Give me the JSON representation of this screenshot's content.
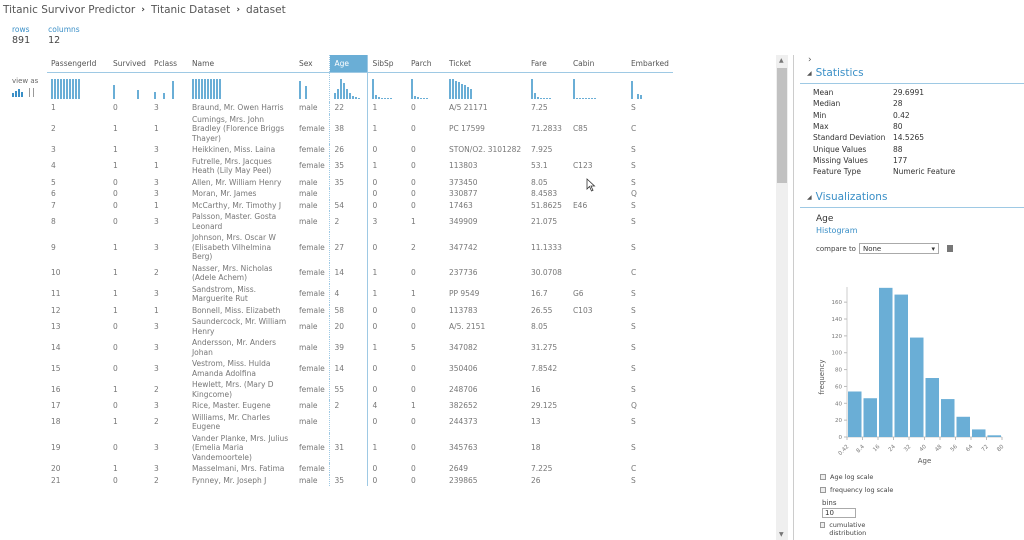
{
  "breadcrumb": [
    "Titanic Survivor Predictor",
    "Titanic Dataset",
    "dataset"
  ],
  "summary": {
    "rows_label": "rows",
    "rows": "891",
    "columns_label": "columns",
    "columns": "12"
  },
  "view_as_label": "view as",
  "columns": [
    "PassengerId",
    "Survived",
    "Pclass",
    "Name",
    "Sex",
    "Age",
    "SibSp",
    "Parch",
    "Ticket",
    "Fare",
    "Cabin",
    "Embarked"
  ],
  "selected_column": "Age",
  "rows": [
    [
      "1",
      "0",
      "3",
      "Braund, Mr. Owen Harris",
      "male",
      "22",
      "1",
      "0",
      "A/5 21171",
      "7.25",
      "",
      "S"
    ],
    [
      "2",
      "1",
      "1",
      "Cumings, Mrs. John Bradley (Florence Briggs Thayer)",
      "female",
      "38",
      "1",
      "0",
      "PC 17599",
      "71.2833",
      "C85",
      "C"
    ],
    [
      "3",
      "1",
      "3",
      "Heikkinen, Miss. Laina",
      "female",
      "26",
      "0",
      "0",
      "STON/O2. 3101282",
      "7.925",
      "",
      "S"
    ],
    [
      "4",
      "1",
      "1",
      "Futrelle, Mrs. Jacques Heath (Lily May Peel)",
      "female",
      "35",
      "1",
      "0",
      "113803",
      "53.1",
      "C123",
      "S"
    ],
    [
      "5",
      "0",
      "3",
      "Allen, Mr. William Henry",
      "male",
      "35",
      "0",
      "0",
      "373450",
      "8.05",
      "",
      "S"
    ],
    [
      "6",
      "0",
      "3",
      "Moran, Mr. James",
      "male",
      "",
      "0",
      "0",
      "330877",
      "8.4583",
      "",
      "Q"
    ],
    [
      "7",
      "0",
      "1",
      "McCarthy, Mr. Timothy J",
      "male",
      "54",
      "0",
      "0",
      "17463",
      "51.8625",
      "E46",
      "S"
    ],
    [
      "8",
      "0",
      "3",
      "Palsson, Master. Gosta Leonard",
      "male",
      "2",
      "3",
      "1",
      "349909",
      "21.075",
      "",
      "S"
    ],
    [
      "9",
      "1",
      "3",
      "Johnson, Mrs. Oscar W (Elisabeth Vilhelmina Berg)",
      "female",
      "27",
      "0",
      "2",
      "347742",
      "11.1333",
      "",
      "S"
    ],
    [
      "10",
      "1",
      "2",
      "Nasser, Mrs. Nicholas (Adele Achem)",
      "female",
      "14",
      "1",
      "0",
      "237736",
      "30.0708",
      "",
      "C"
    ],
    [
      "11",
      "1",
      "3",
      "Sandstrom, Miss. Marguerite Rut",
      "female",
      "4",
      "1",
      "1",
      "PP 9549",
      "16.7",
      "G6",
      "S"
    ],
    [
      "12",
      "1",
      "1",
      "Bonnell, Miss. Elizabeth",
      "female",
      "58",
      "0",
      "0",
      "113783",
      "26.55",
      "C103",
      "S"
    ],
    [
      "13",
      "0",
      "3",
      "Saundercock, Mr. William Henry",
      "male",
      "20",
      "0",
      "0",
      "A/5. 2151",
      "8.05",
      "",
      "S"
    ],
    [
      "14",
      "0",
      "3",
      "Andersson, Mr. Anders Johan",
      "male",
      "39",
      "1",
      "5",
      "347082",
      "31.275",
      "",
      "S"
    ],
    [
      "15",
      "0",
      "3",
      "Vestrom, Miss. Hulda Amanda Adolfina",
      "female",
      "14",
      "0",
      "0",
      "350406",
      "7.8542",
      "",
      "S"
    ],
    [
      "16",
      "1",
      "2",
      "Hewlett, Mrs. (Mary D Kingcome)",
      "female",
      "55",
      "0",
      "0",
      "248706",
      "16",
      "",
      "S"
    ],
    [
      "17",
      "0",
      "3",
      "Rice, Master. Eugene",
      "male",
      "2",
      "4",
      "1",
      "382652",
      "29.125",
      "",
      "Q"
    ],
    [
      "18",
      "1",
      "2",
      "Williams, Mr. Charles Eugene",
      "male",
      "",
      "0",
      "0",
      "244373",
      "13",
      "",
      "S"
    ],
    [
      "19",
      "0",
      "3",
      "Vander Planke, Mrs. Julius (Emelia Maria Vandemoortele)",
      "female",
      "31",
      "1",
      "0",
      "345763",
      "18",
      "",
      "S"
    ],
    [
      "20",
      "1",
      "3",
      "Masselmani, Mrs. Fatima",
      "female",
      "",
      "0",
      "0",
      "2649",
      "7.225",
      "",
      "C"
    ],
    [
      "21",
      "0",
      "2",
      "Fynney, Mr. Joseph J",
      "male",
      "35",
      "0",
      "0",
      "239865",
      "26",
      "",
      "S"
    ]
  ],
  "panel": {
    "statistics_title": "Statistics",
    "statistics": [
      {
        "label": "Mean",
        "value": "29.6991"
      },
      {
        "label": "Median",
        "value": "28"
      },
      {
        "label": "Min",
        "value": "0.42"
      },
      {
        "label": "Max",
        "value": "80"
      },
      {
        "label": "Standard Deviation",
        "value": "14.5265"
      },
      {
        "label": "Unique Values",
        "value": "88"
      },
      {
        "label": "Missing Values",
        "value": "177"
      },
      {
        "label": "Feature Type",
        "value": "Numeric Feature"
      }
    ],
    "visualizations_title": "Visualizations",
    "viz_feature": "Age",
    "viz_type": "Histogram",
    "compare_label": "compare to",
    "compare_value": "None",
    "options": {
      "x_log": "Age log scale",
      "y_log": "frequency log scale",
      "bins_label": "bins",
      "bins_value": "10",
      "cumulative": "cumulative distribution"
    }
  },
  "chart_data": {
    "type": "bar",
    "title": "",
    "xlabel": "Age",
    "ylabel": "frequency",
    "x_tick_labels": [
      "0.42",
      "8.4",
      "16",
      "24",
      "32",
      "40",
      "48",
      "56",
      "64",
      "72",
      "80"
    ],
    "y_ticks": [
      0,
      20,
      40,
      60,
      80,
      100,
      120,
      140,
      160
    ],
    "ylim": [
      0,
      178
    ],
    "categories": [
      "0.42-8.4",
      "8.4-16",
      "16-24",
      "24-32",
      "32-40",
      "40-48",
      "48-56",
      "56-64",
      "64-72",
      "72-80"
    ],
    "values": [
      54,
      46,
      177,
      169,
      118,
      70,
      45,
      24,
      9,
      2
    ]
  }
}
